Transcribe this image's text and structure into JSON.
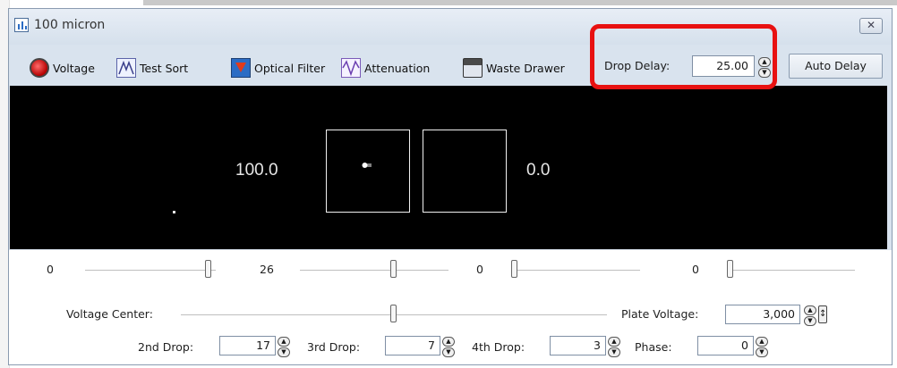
{
  "window": {
    "title": "100 micron",
    "close_glyph": "✕"
  },
  "toolbar": {
    "voltage": "Voltage",
    "test_sort": "Test Sort",
    "optical_filter": "Optical Filter",
    "attenuation": "Attenuation",
    "waste_drawer": "Waste Drawer",
    "drop_delay_label": "Drop Delay:",
    "drop_delay_value": "25.00",
    "auto_delay": "Auto Delay"
  },
  "display": {
    "left_value": "100.0",
    "right_value": "0.0"
  },
  "sliders": [
    {
      "label": "0",
      "position": 0.92
    },
    {
      "label": "26",
      "position": 0.61
    },
    {
      "label": "0",
      "position": 0.0
    },
    {
      "label": "0",
      "position": 0.0
    }
  ],
  "voltage_center": {
    "label": "Voltage Center:",
    "position": 0.5
  },
  "plate_voltage": {
    "label": "Plate Voltage:",
    "value": "3,000"
  },
  "drops": {
    "second": {
      "label": "2nd Drop:",
      "value": "17"
    },
    "third": {
      "label": "3rd Drop:",
      "value": "7"
    },
    "fourth": {
      "label": "4th Drop:",
      "value": "3"
    },
    "phase": {
      "label": "Phase:",
      "value": "0"
    }
  },
  "icons": {
    "spin_up": "▲",
    "spin_down": "▼",
    "plate_arrow": "↕"
  },
  "colors": {
    "highlight": "#e81111",
    "display_bg": "#000000"
  }
}
